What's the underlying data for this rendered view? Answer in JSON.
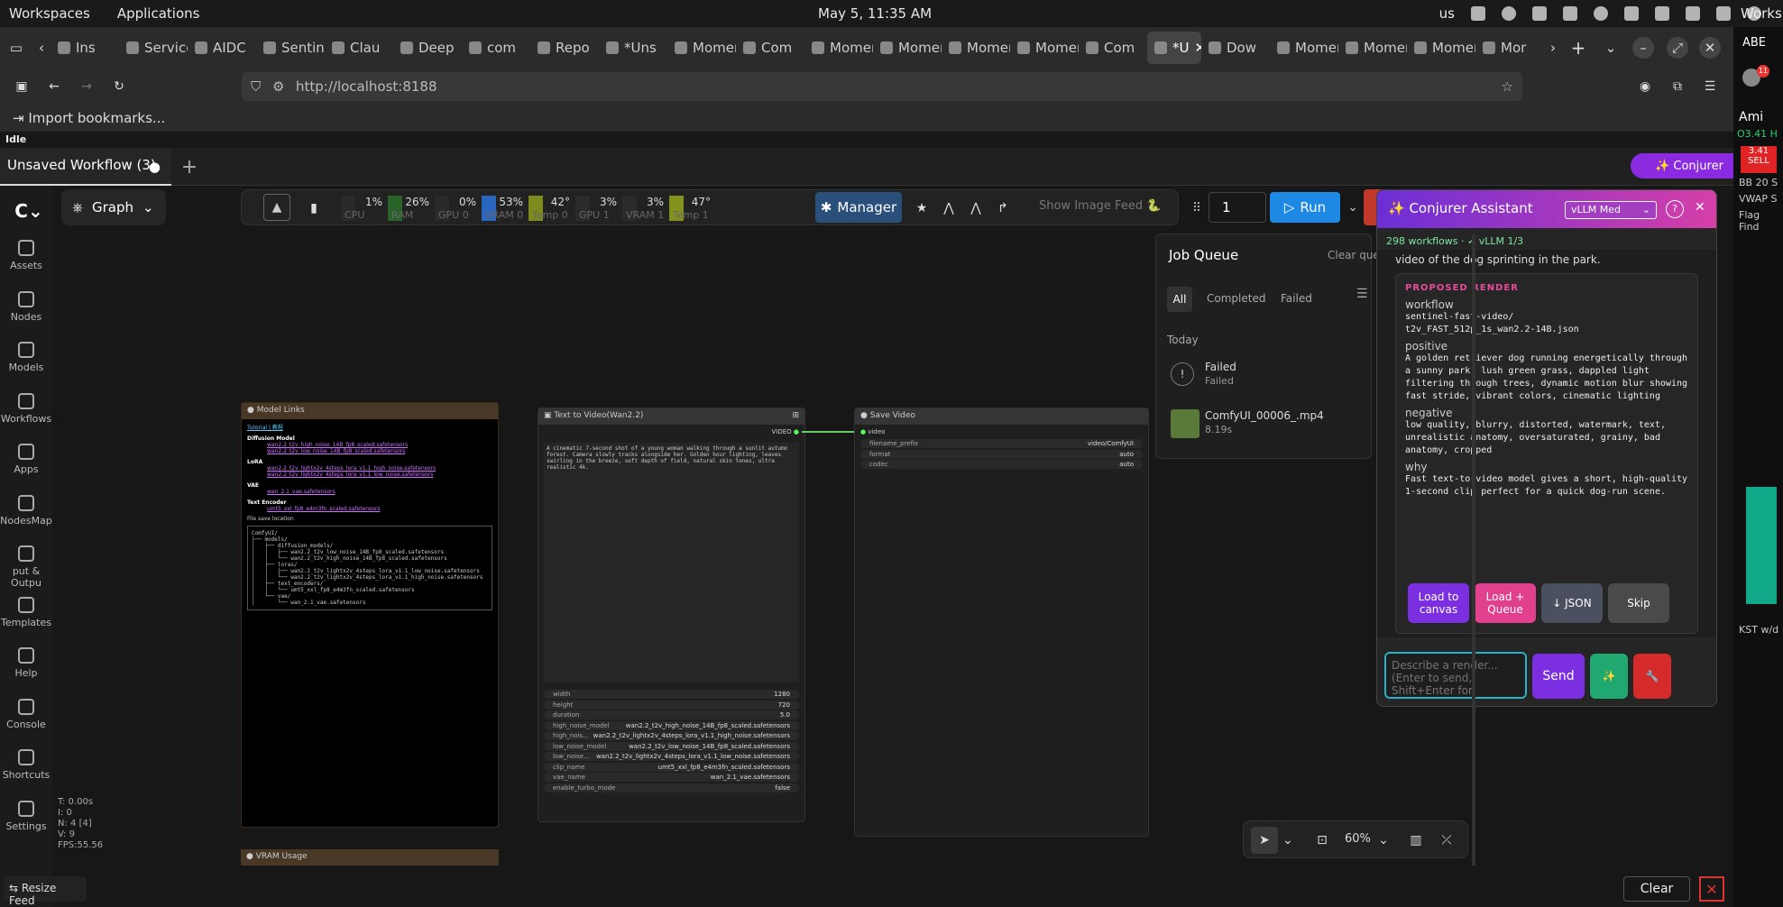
{
  "os": {
    "left_items": [
      "Workspaces",
      "Applications"
    ],
    "clock": "May 5, 11:35 AM",
    "keyboard": "us",
    "right_cut_label": "Worksp"
  },
  "browser": {
    "tabs": [
      "Ins",
      "Service",
      "AIDC",
      "Sentinel",
      "Clau",
      "Deep",
      "com",
      "Repo",
      "*Uns",
      "Momen",
      "Com",
      "Momen",
      "Momen",
      "Momen",
      "Momen",
      "Com",
      "*U",
      "Dow",
      "Momen",
      "Momen",
      "Momen",
      "Mor"
    ],
    "active_tab_index": 16,
    "url": "http://localhost:8188",
    "bookmarks_import": "Import bookmarks..."
  },
  "app": {
    "status": "Idle",
    "workflow_tab": "Unsaved Workflow (3)",
    "sidebar": [
      {
        "label": "Assets",
        "icon": "assets-icon"
      },
      {
        "label": "Nodes",
        "icon": "nodes-icon"
      },
      {
        "label": "Models",
        "icon": "models-icon"
      },
      {
        "label": "Workflows",
        "icon": "workflows-icon"
      },
      {
        "label": "Apps",
        "icon": "apps-icon"
      },
      {
        "label": "NodesMap",
        "icon": "nodesmap-icon"
      },
      {
        "label": "put & Outpu",
        "icon": "io-icon"
      },
      {
        "label": "Templates",
        "icon": "templates-icon"
      },
      {
        "label": "Help",
        "icon": "help-icon"
      },
      {
        "label": "Console",
        "icon": "console-icon"
      },
      {
        "label": "Shortcuts",
        "icon": "keyboard-icon"
      },
      {
        "label": "Settings",
        "icon": "gear-icon"
      }
    ],
    "graph_label": "Graph",
    "stats": [
      "T: 0.00s",
      "I: 0",
      "N: 4 [4]",
      "V: 9",
      "FPS:55.56"
    ],
    "resize_feed": "Resize Feed",
    "conjurer_button": "✨ Conjurer",
    "clear": "Clear"
  },
  "toolbar": {
    "meters": [
      {
        "label": "CPU",
        "pct": "1%",
        "value": 1,
        "color": "#3a3a3a"
      },
      {
        "label": "RAM",
        "pct": "26%",
        "value": 26,
        "color": "#2e8b2e"
      },
      {
        "label": "GPU 0",
        "pct": "0%",
        "value": 0,
        "color": "#3a3a3a"
      },
      {
        "label": "VRAM 0",
        "pct": "53%",
        "value": 53,
        "color": "#2a6fd6"
      },
      {
        "label": "Temp 0",
        "pct": "42°",
        "value": 42,
        "color": "#9aab1c"
      },
      {
        "label": "GPU 1",
        "pct": "3%",
        "value": 3,
        "color": "#3a3a3a"
      },
      {
        "label": "VRAM 1",
        "pct": "3%",
        "value": 3,
        "color": "#3a3a3a"
      },
      {
        "label": "Temp 1",
        "pct": "47°",
        "value": 47,
        "color": "#9aab1c"
      }
    ],
    "manager": "Manager",
    "show_feed": "Show Image Feed 🐍",
    "batch": "1",
    "run": "Run"
  },
  "nodes": {
    "model_links": {
      "title": "Model Links",
      "links": "Tutorial | 教程",
      "sections": [
        {
          "h": "Diffusion Model",
          "items": [
            "wan2.2_t2v_high_noise_14B_fp8_scaled.safetensors",
            "wan2.2_t2v_low_noise_14B_fp8_scaled.safetensors"
          ]
        },
        {
          "h": "LoRA",
          "items": [
            "wan2.2_t2v_lightx2v_4steps_lora_v1.1_high_noise.safetensors",
            "wan2.2_t2v_lightx2v_4steps_lora_v1.1_low_noise.safetensors"
          ]
        },
        {
          "h": "VAE",
          "items": [
            "wan_2.1_vae.safetensors"
          ]
        },
        {
          "h": "Text Encoder",
          "items": [
            "umt5_xxl_fp8_e4m3fn_scaled.safetensors"
          ]
        }
      ],
      "file_save_location": "File save location",
      "tree": [
        "ComfyUI/",
        "├── models/",
        "│   ├── diffusion_models/",
        "│   │   ├── wan2.2_t2v_low_noise_14B_fp8_scaled.safetensors",
        "│   │   └── wan2.2_t2v_high_noise_14B_fp8_scaled.safetensors",
        "│   ├── loras/",
        "│   │   ├── wan2.2_t2v_lightx2v_4steps_lora_v1.1_low_noise.safetensors",
        "│   │   └── wan2.2_t2v_lightx2v_4steps_lora_v1.1_high_noise.safetensors",
        "│   ├── text_encoders/",
        "│   │   └── umt5_xxl_fp8_e4m3fn_scaled.safetensors",
        "│   └── vae/",
        "│       └── wan_2.1_vae.safetensors"
      ]
    },
    "vram": "VRAM Usage",
    "t2v": {
      "title": "Text to Video(Wan2.2)",
      "output": "VIDEO",
      "prompt": "A cinematic 7-second shot of a young woman walking through a sunlit autumn forest. Camera slowly tracks alongside her. Golden hour lighting, leaves swirling in the breeze, soft depth of field, natural skin tones, ultra realistic 4k.",
      "widgets": [
        {
          "k": "width",
          "v": "1280"
        },
        {
          "k": "height",
          "v": "720"
        },
        {
          "k": "duration",
          "v": "5.0"
        },
        {
          "k": "high_noise_model",
          "v": "wan2.2_t2v_high_noise_14B_fp8_scaled.safetensors"
        },
        {
          "k": "high_nois...",
          "v": "wan2.2_t2v_lightx2v_4steps_lora_v1.1_high_noise.safetensors"
        },
        {
          "k": "low_noise_model",
          "v": "wan2.2_t2v_low_noise_14B_fp8_scaled.safetensors"
        },
        {
          "k": "low_noise...",
          "v": "wan2.2_t2v_lightx2v_4steps_lora_v1.1_low_noise.safetensors"
        },
        {
          "k": "clip_name",
          "v": "umt5_xxl_fp8_e4m3fn_scaled.safetensors"
        },
        {
          "k": "vae_name",
          "v": "wan_2.1_vae.safetensors"
        },
        {
          "k": "enable_turbo_mode",
          "v": "false"
        }
      ]
    },
    "save": {
      "title": "Save Video",
      "input": "video",
      "widgets": [
        {
          "k": "filename_prefix",
          "v": "video/ComfyUI"
        },
        {
          "k": "format",
          "v": "auto"
        },
        {
          "k": "codec",
          "v": "auto"
        }
      ]
    }
  },
  "job_queue": {
    "title": "Job Queue",
    "clear": "Clear que",
    "filters": [
      "All",
      "Completed",
      "Failed"
    ],
    "group": "Today",
    "jobs": [
      {
        "name": "Failed",
        "sub": "Failed"
      },
      {
        "name": "ComfyUI_00006_.mp4",
        "sub": "8.19s"
      }
    ]
  },
  "conjurer": {
    "title": "✨ Conjurer Assistant",
    "model": "vLLM Med",
    "status": "298 workflows · ✓ vLLM 1/3",
    "prev_text": "video of the dog sprinting in the park.",
    "proposed": "PROPOSED RENDER",
    "workflow_label": "workflow",
    "workflow": "sentinel-fast-video/\nt2v_FAST_512p_1s_wan2.2-14B.json",
    "positive_label": "positive",
    "positive": "A golden retriever dog running energetically through a sunny park, lush green grass, dappled light filtering through trees, dynamic motion blur showing fast stride, vibrant colors, cinematic lighting",
    "negative_label": "negative",
    "negative": "low quality, blurry, distorted, watermark, text, unrealistic anatomy, oversaturated, grainy, bad anatomy, cropped",
    "why_label": "why",
    "why": "Fast text-to-video model gives a short, high-quality 1-second clip perfect for a quick dog-run scene.",
    "buttons": [
      "Load to canvas",
      "Load + Queue",
      "↓ JSON",
      "Skip"
    ],
    "placeholder": "Describe a render...  (Enter to send, Shift+Enter for",
    "send": "Send"
  },
  "zoom": "60%",
  "right_window": {
    "items": [
      "ABE",
      "Ami",
      "O3.41 H",
      "3.41",
      "SELL",
      "BB 20 S",
      "VWAP S",
      "Flag Find",
      "KST w/d"
    ]
  }
}
